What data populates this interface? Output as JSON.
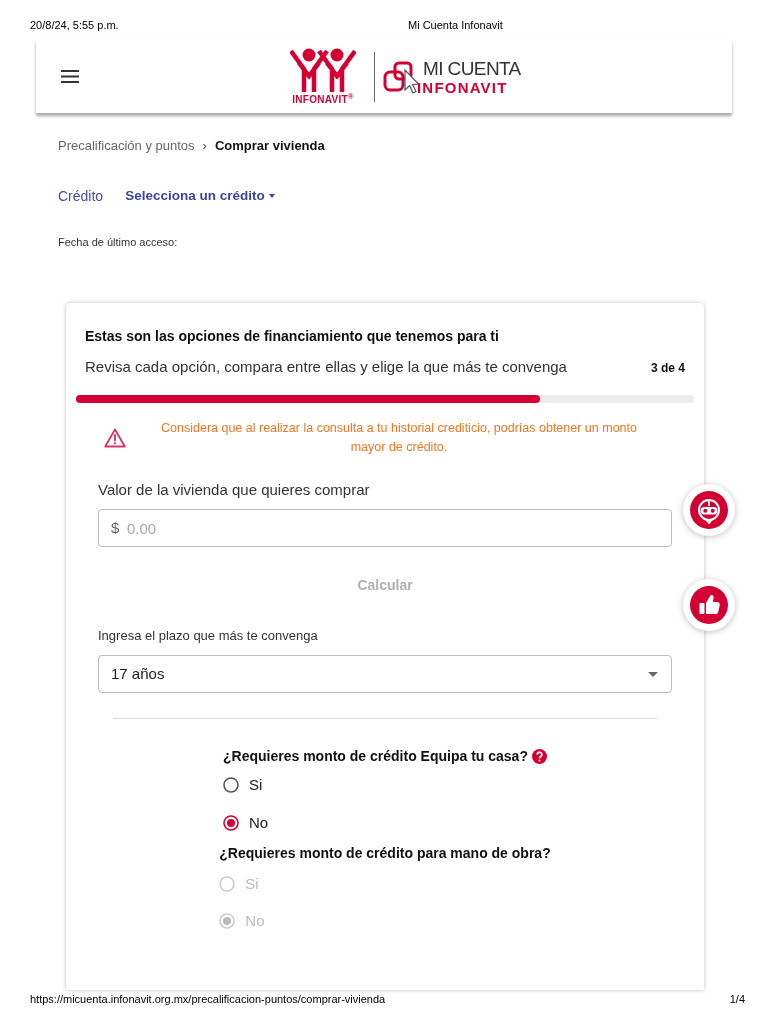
{
  "print_header": {
    "date": "20/8/24, 5:55 p.m.",
    "title": "Mi Cuenta Infonavit"
  },
  "header": {
    "logo_text": "INFONAVIT$^{®}$",
    "brand_line_1": "MI CUENTA",
    "brand_line_2": "INFONAVIT"
  },
  "breadcrumb": {
    "separator": "›",
    "items": [
      {
        "label": "Precalificación y puntos",
        "current": false
      },
      {
        "label": "Comprar vivienda",
        "current": true
      }
    ]
  },
  "credit_bar": {
    "label": "Crédito",
    "dropdown": "Selecciona un crédito"
  },
  "last_access": {
    "label": "Fecha de último acceso:"
  },
  "card": {
    "title": "Estas son las opciones de financiamiento que tenemos para ti",
    "subtitle": "Revisa cada opción, compara entre ellas y elige la que más te convenga",
    "step": "3 de 4",
    "progress": {
      "level": 0.75
    },
    "notice": {
      "kind": "warning",
      "text": "Considera que al realizar la consulta a tu historial crediticio, podrías obtener un monto mayor de crédito."
    },
    "price_field": {
      "label": "Valor de la vivienda que quieres comprar",
      "prefix": "$",
      "placeholder": "0.00"
    },
    "calculate_button": {
      "label": "Calcular",
      "disabled": true
    },
    "term_field": {
      "label": "Ingresa el plazo que más te convenga",
      "value": "17 años"
    },
    "questions": [
      {
        "text": "¿Requieres monto de crédito Equipa tu casa?",
        "help": true,
        "disabled": false,
        "options": [
          {
            "label": "Si",
            "selected": false
          },
          {
            "label": "No",
            "selected": true
          }
        ]
      },
      {
        "text": "¿Requieres monto de crédito para mano de obra?",
        "help": false,
        "disabled": true,
        "options": [
          {
            "label": "Si",
            "selected": false
          },
          {
            "label": "No",
            "selected": true
          }
        ]
      }
    ]
  },
  "floating_buttons": [
    {
      "kind": "chatbot"
    },
    {
      "kind": "like"
    }
  ],
  "print_footer": {
    "url": "https://micuenta.infonavit.org.mx/precalificacion-puntos/comprar-vivienda",
    "page": "1/4"
  }
}
